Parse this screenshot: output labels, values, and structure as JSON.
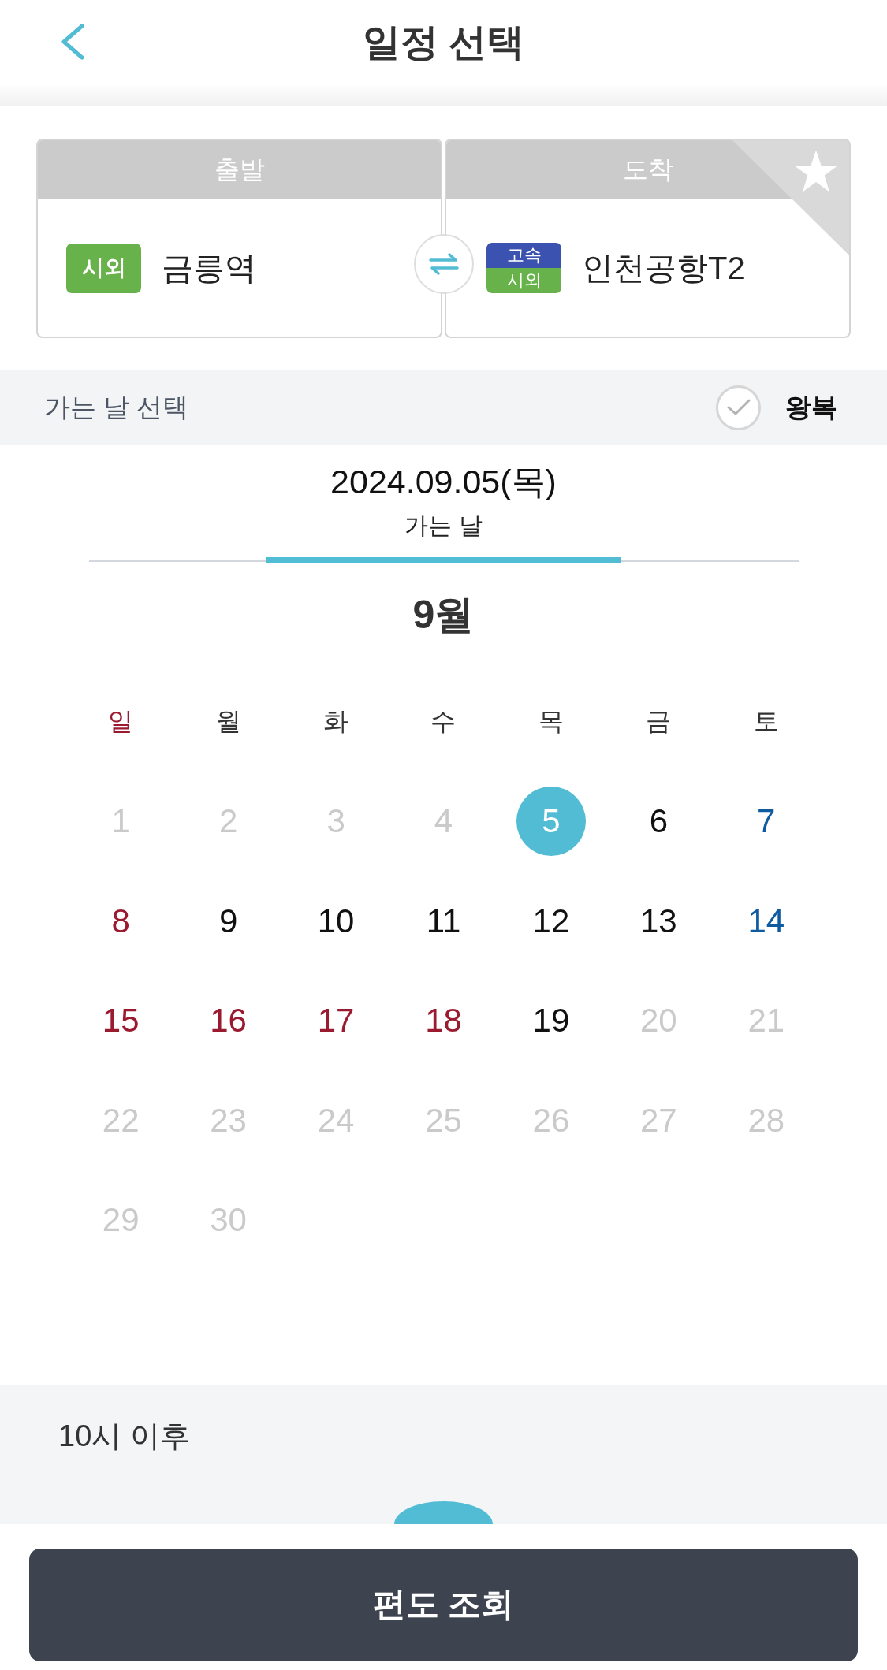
{
  "header": {
    "title": "일정 선택"
  },
  "route": {
    "departure": {
      "label": "출발",
      "badges": [
        {
          "text": "시외",
          "color": "#68b24b"
        }
      ],
      "station": "금릉역"
    },
    "arrival": {
      "label": "도착",
      "badges": [
        {
          "text": "고속",
          "color": "#3c52b0"
        },
        {
          "text": "시외",
          "color": "#68b24b"
        }
      ],
      "station": "인천공항T2",
      "favorite": false
    }
  },
  "date_bar": {
    "label": "가는 날 선택",
    "round_trip": {
      "label": "왕복",
      "checked": false
    }
  },
  "selected_date": {
    "date": "2024.09.05(목)",
    "caption": "가는 날"
  },
  "calendar": {
    "month": "9월",
    "weekdays": [
      {
        "label": "일",
        "kind": "sunday"
      },
      {
        "label": "월",
        "kind": "default"
      },
      {
        "label": "화",
        "kind": "default"
      },
      {
        "label": "수",
        "kind": "default"
      },
      {
        "label": "목",
        "kind": "default"
      },
      {
        "label": "금",
        "kind": "default"
      },
      {
        "label": "토",
        "kind": "default"
      }
    ],
    "days": [
      {
        "day": "1",
        "disabled": true,
        "selected": false
      },
      {
        "day": "2",
        "disabled": true,
        "selected": false
      },
      {
        "day": "3",
        "disabled": true,
        "selected": false
      },
      {
        "day": "4",
        "disabled": true,
        "selected": false
      },
      {
        "day": "5",
        "kind": "weekday",
        "disabled": false,
        "selected": true
      },
      {
        "day": "6",
        "kind": "weekday",
        "disabled": false,
        "selected": false
      },
      {
        "day": "7",
        "kind": "saturday",
        "disabled": false,
        "selected": false
      },
      {
        "day": "8",
        "kind": "sunday",
        "disabled": false,
        "selected": false
      },
      {
        "day": "9",
        "kind": "weekday",
        "disabled": false,
        "selected": false
      },
      {
        "day": "10",
        "kind": "weekday",
        "disabled": false,
        "selected": false
      },
      {
        "day": "11",
        "kind": "weekday",
        "disabled": false,
        "selected": false
      },
      {
        "day": "12",
        "kind": "weekday",
        "disabled": false,
        "selected": false
      },
      {
        "day": "13",
        "kind": "weekday",
        "disabled": false,
        "selected": false
      },
      {
        "day": "14",
        "kind": "saturday",
        "disabled": false,
        "selected": false
      },
      {
        "day": "15",
        "kind": "sunday",
        "disabled": false,
        "selected": false
      },
      {
        "day": "16",
        "kind": "holiday",
        "disabled": false,
        "selected": false
      },
      {
        "day": "17",
        "kind": "holiday",
        "disabled": false,
        "selected": false
      },
      {
        "day": "18",
        "kind": "holiday",
        "disabled": false,
        "selected": false
      },
      {
        "day": "19",
        "kind": "weekday",
        "disabled": false,
        "selected": false
      },
      {
        "day": "20",
        "disabled": true,
        "selected": false
      },
      {
        "day": "21",
        "disabled": true,
        "selected": false
      },
      {
        "day": "22",
        "disabled": true,
        "selected": false
      },
      {
        "day": "23",
        "disabled": true,
        "selected": false
      },
      {
        "day": "24",
        "disabled": true,
        "selected": false
      },
      {
        "day": "25",
        "disabled": true,
        "selected": false
      },
      {
        "day": "26",
        "disabled": true,
        "selected": false
      },
      {
        "day": "27",
        "disabled": true,
        "selected": false
      },
      {
        "day": "28",
        "disabled": true,
        "selected": false
      },
      {
        "day": "29",
        "disabled": true,
        "selected": false
      },
      {
        "day": "30",
        "disabled": true,
        "selected": false
      }
    ]
  },
  "time_filter": {
    "label": "10시 이후"
  },
  "search_button": {
    "label": "편도 조회"
  }
}
